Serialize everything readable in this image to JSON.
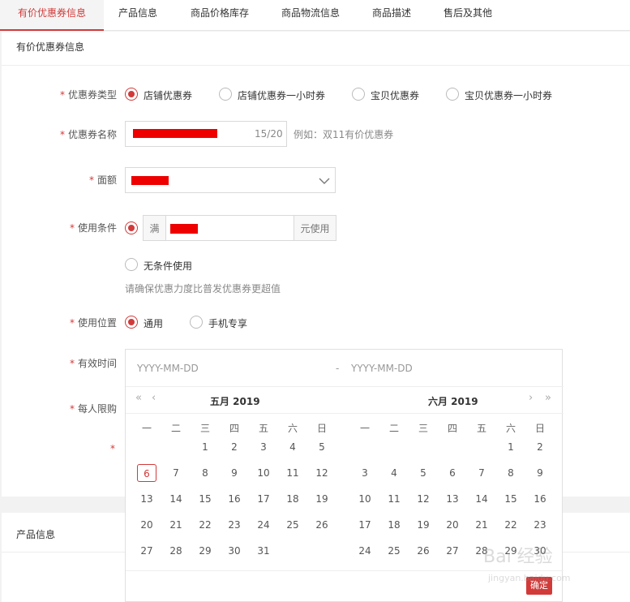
{
  "tabs": [
    "有价优惠券信息",
    "产品信息",
    "商品价格库存",
    "商品物流信息",
    "商品描述",
    "售后及其他"
  ],
  "section_title": "有价优惠券信息",
  "section2_title": "产品信息",
  "form": {
    "coupon_type": {
      "label": "优惠券类型",
      "options": [
        "店铺优惠券",
        "店铺优惠券一小时券",
        "宝贝优惠券",
        "宝贝优惠券一小时券"
      ],
      "selected": 0
    },
    "coupon_name": {
      "label": "优惠券名称",
      "counter": "15/20",
      "hint": "例如：双11有价优惠券"
    },
    "face_value": {
      "label": "面额"
    },
    "use_condition": {
      "label": "使用条件",
      "prefix": "满",
      "suffix": "元使用",
      "no_condition_label": "无条件使用",
      "tip": "请确保优惠力度比普发优惠券更超值"
    },
    "use_location": {
      "label": "使用位置",
      "options": [
        "通用",
        "手机专享"
      ],
      "selected": 0
    },
    "valid_time": {
      "label": "有效时间"
    },
    "per_person_limit": {
      "label": "每人限购"
    }
  },
  "datepicker": {
    "start_placeholder": "YYYY-MM-DD",
    "separator": "-",
    "end_placeholder": "YYYY-MM-DD",
    "nav": {
      "prev_year": "«",
      "prev_month": "‹",
      "next_month": "›",
      "next_year": "»"
    },
    "weekdays": [
      "一",
      "二",
      "三",
      "四",
      "五",
      "六",
      "日"
    ],
    "left_month": {
      "title": "五月  2019",
      "first_weekday_index": 2,
      "days": [
        1,
        2,
        3,
        4,
        5,
        6,
        7,
        8,
        9,
        10,
        11,
        12,
        13,
        14,
        15,
        16,
        17,
        18,
        19,
        20,
        21,
        22,
        23,
        24,
        25,
        26,
        27,
        28,
        29,
        30,
        31
      ],
      "today": 6
    },
    "right_month": {
      "title": "六月  2019",
      "first_weekday_index": 5,
      "days": [
        1,
        2,
        3,
        4,
        5,
        6,
        7,
        8,
        9,
        10,
        11,
        12,
        13,
        14,
        15,
        16,
        17,
        18,
        19,
        20,
        21,
        22,
        23,
        24,
        25,
        26,
        27,
        28,
        29,
        30
      ]
    },
    "confirm_label": "确定"
  },
  "watermark": {
    "big": "Bai 经验",
    "small": "jingyan.baidu.com"
  },
  "colors": {
    "accent": "#d23a3a",
    "redaction": "#ee0000"
  }
}
